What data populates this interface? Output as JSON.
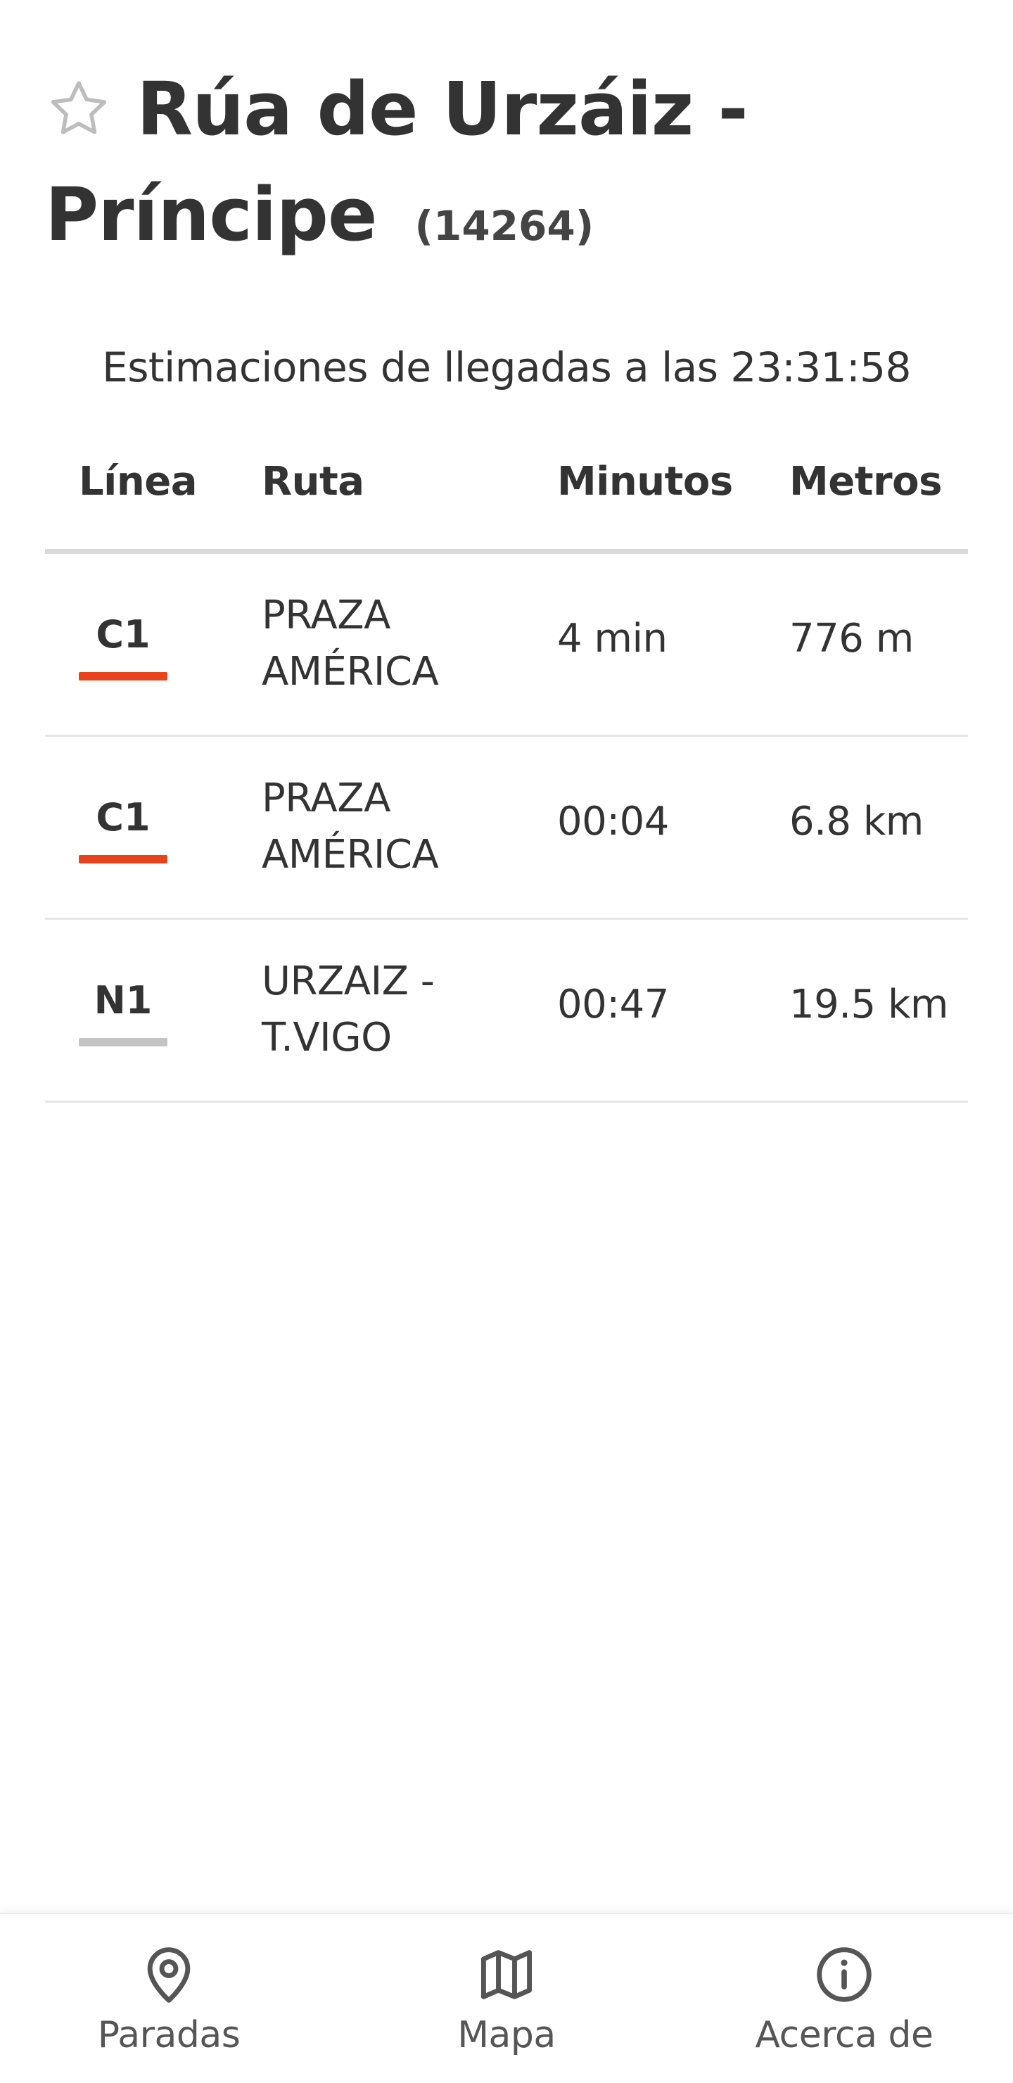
{
  "stop": {
    "title_line1": "Rúa de Urzáiz -",
    "title_line2": "Príncipe",
    "code": "(14264)"
  },
  "estimations_text": "Estimaciones de llegadas a las 23:31:58",
  "table": {
    "headers": {
      "line": "Línea",
      "route": "Ruta",
      "minutes": "Minutos",
      "meters": "Metros"
    },
    "rows": [
      {
        "line": "C1",
        "line_color": "#e8431a",
        "route": "PRAZA AMÉRICA",
        "minutes": "4 min",
        "meters": "776 m"
      },
      {
        "line": "C1",
        "line_color": "#e8431a",
        "route": "PRAZA AMÉRICA",
        "minutes": "00:04",
        "meters": "6.8 km"
      },
      {
        "line": "N1",
        "line_color": "#c4c4c4",
        "route": "URZAIZ - T.VIGO",
        "minutes": "00:47",
        "meters": "19.5 km"
      }
    ]
  },
  "nav": {
    "stops": {
      "label": "Paradas",
      "icon": "map-pin-icon"
    },
    "map": {
      "label": "Mapa",
      "icon": "map-icon"
    },
    "about": {
      "label": "Acerca de",
      "icon": "info-icon"
    }
  },
  "icons": {
    "favorite": "star-outline-icon"
  },
  "colors": {
    "text": "#333333",
    "accent_c1": "#e8431a",
    "accent_n1": "#c4c4c4",
    "star": "#bdbdbd"
  }
}
